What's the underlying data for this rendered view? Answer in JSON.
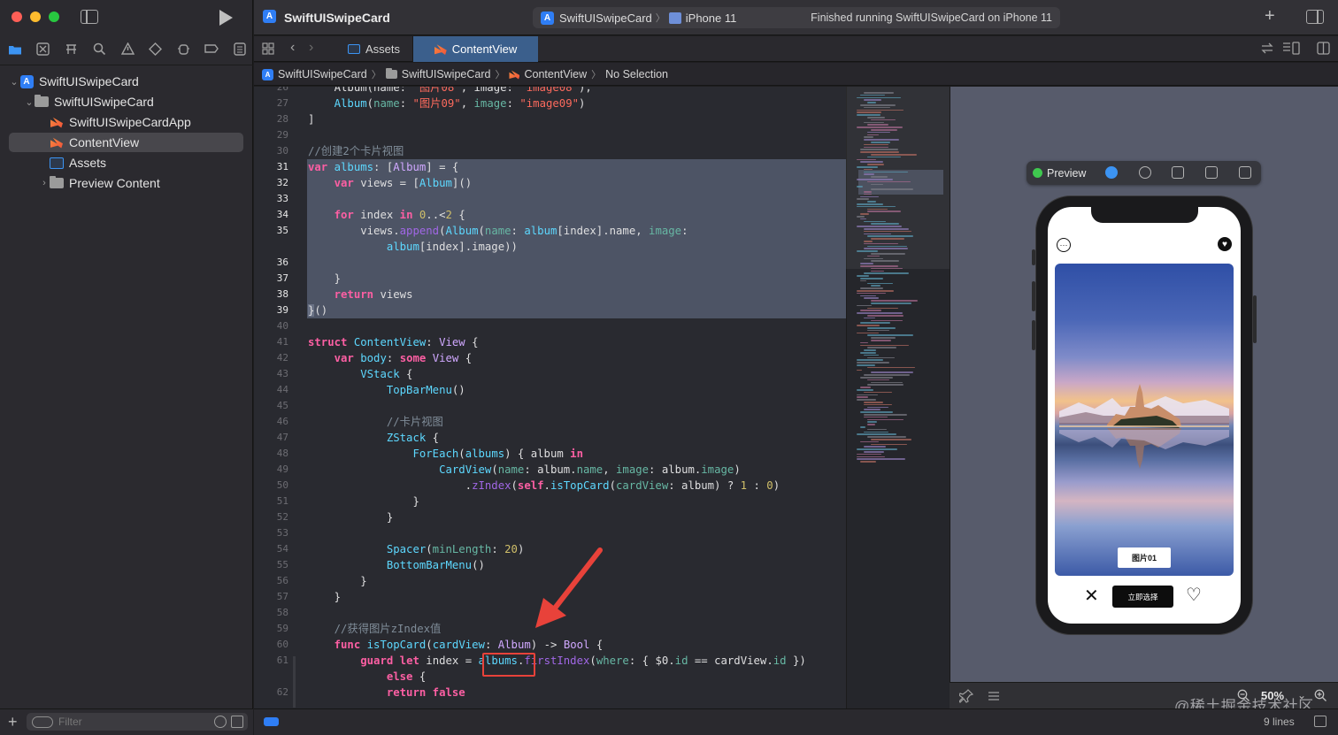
{
  "window": {
    "app_title": "SwiftUISwipeCard",
    "scheme": "SwiftUISwipeCard",
    "device": "iPhone 11",
    "status": "Finished running SwiftUISwipeCard on iPhone 11"
  },
  "tabs": [
    {
      "label": "Assets"
    },
    {
      "label": "ContentView"
    }
  ],
  "breadcrumb": [
    "SwiftUISwipeCard",
    "SwiftUISwipeCard",
    "ContentView",
    "No Selection"
  ],
  "navigator": {
    "items": [
      {
        "label": "SwiftUISwipeCard",
        "kind": "project"
      },
      {
        "label": "SwiftUISwipeCard",
        "kind": "folder"
      },
      {
        "label": "SwiftUISwipeCardApp",
        "kind": "swift"
      },
      {
        "label": "ContentView",
        "kind": "swift",
        "selected": true
      },
      {
        "label": "Assets",
        "kind": "assets"
      },
      {
        "label": "Preview Content",
        "kind": "folder"
      }
    ],
    "filter_placeholder": "Filter"
  },
  "editor": {
    "lines": [
      {
        "n": "27",
        "code": "    Album(name: \"图片09\", image: \"image09\")"
      },
      {
        "n": "28",
        "code": "]"
      },
      {
        "n": "29",
        "code": ""
      },
      {
        "n": "30",
        "code": "//创建2个卡片视图"
      },
      {
        "n": "31",
        "code": "var albums: [Album] = {"
      },
      {
        "n": "32",
        "code": "    var views = [Album]()"
      },
      {
        "n": "33",
        "code": ""
      },
      {
        "n": "34",
        "code": "    for index in 0..<2 {"
      },
      {
        "n": "35",
        "code": "        views.append(Album(name: album[index].name, image:"
      },
      {
        "n": "",
        "code": "            album[index].image))"
      },
      {
        "n": "36",
        "code": ""
      },
      {
        "n": "37",
        "code": "    }"
      },
      {
        "n": "38",
        "code": "    return views"
      },
      {
        "n": "39",
        "code": "}()"
      },
      {
        "n": "40",
        "code": ""
      },
      {
        "n": "41",
        "code": "struct ContentView: View {"
      },
      {
        "n": "42",
        "code": "    var body: some View {"
      },
      {
        "n": "43",
        "code": "        VStack {"
      },
      {
        "n": "44",
        "code": "            TopBarMenu()"
      },
      {
        "n": "45",
        "code": ""
      },
      {
        "n": "46",
        "code": "            //卡片视图"
      },
      {
        "n": "47",
        "code": "            ZStack {"
      },
      {
        "n": "48",
        "code": "                ForEach(albums) { album in"
      },
      {
        "n": "49",
        "code": "                    CardView(name: album.name, image: album.image)"
      },
      {
        "n": "50",
        "code": "                        .zIndex(self.isTopCard(cardView: album) ? 1 : 0)"
      },
      {
        "n": "51",
        "code": "                }"
      },
      {
        "n": "52",
        "code": "            }"
      },
      {
        "n": "53",
        "code": ""
      },
      {
        "n": "54",
        "code": "            Spacer(minLength: 20)"
      },
      {
        "n": "55",
        "code": "            BottomBarMenu()"
      },
      {
        "n": "56",
        "code": "        }"
      },
      {
        "n": "57",
        "code": "    }"
      },
      {
        "n": "58",
        "code": ""
      },
      {
        "n": "59",
        "code": "    //获得图片zIndex值"
      },
      {
        "n": "60",
        "code": "    func isTopCard(cardView: Album) -> Bool {"
      },
      {
        "n": "61",
        "code": "        guard let index = albums.firstIndex(where: { $0.id == cardView.id })"
      },
      {
        "n": "",
        "code": "            else {"
      },
      {
        "n": "62",
        "code": "            return false"
      }
    ],
    "status_lines": "9 lines"
  },
  "preview": {
    "label": "Preview",
    "zoom": "50%",
    "card_label": "图片01",
    "select_button": "立即选择"
  },
  "watermark": "@稀土掘金技术社区",
  "colors": {
    "accent": "#2f7ef5",
    "selection": "#4d5465",
    "annotation": "#e8423a"
  }
}
